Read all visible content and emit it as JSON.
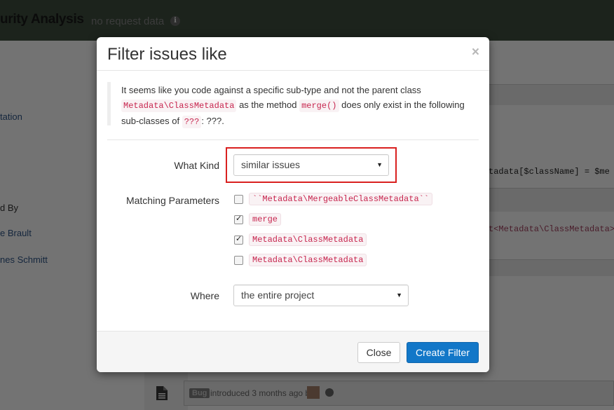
{
  "background": {
    "app_title": "urity Analysis",
    "subtitle": "no request data",
    "left_links": [
      "tation",
      "e Brault",
      "nes Schmitt"
    ],
    "left_label": "d By",
    "code_line": "tadata[$className] = $me",
    "code_line_red": "t<Metadata\\ClassMetadata>",
    "bug_badge": "Bug",
    "introduced_text": "introduced 3 months ago by"
  },
  "modal": {
    "title": "Filter issues like",
    "close_glyph": "×",
    "note": {
      "text_1": "It seems like you code against a specific sub-type and not the parent class",
      "code_1": "Metadata\\ClassMetadata",
      "text_2": "as the method",
      "code_2": "merge()",
      "text_3": "does only exist in the following sub-classes of",
      "code_3": "???",
      "text_4": ": ???."
    },
    "what_kind": {
      "label": "What Kind",
      "value": "similar issues"
    },
    "matching": {
      "label": "Matching Parameters",
      "items": [
        {
          "label": "``Metadata\\MergeableClassMetadata``",
          "checked": false
        },
        {
          "label": "merge",
          "checked": true
        },
        {
          "label": "Metadata\\ClassMetadata",
          "checked": true
        },
        {
          "label": "Metadata\\ClassMetadata",
          "checked": false
        }
      ]
    },
    "where": {
      "label": "Where",
      "value": "the entire project"
    },
    "buttons": {
      "close": "Close",
      "create": "Create Filter"
    }
  },
  "colors": {
    "primary": "#1277c8",
    "highlight": "#d9201f",
    "code": "#c7254e"
  }
}
